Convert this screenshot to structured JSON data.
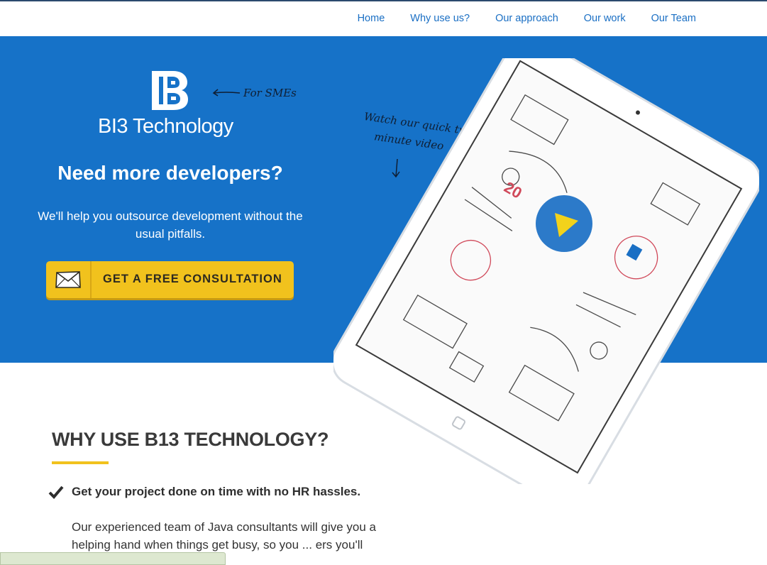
{
  "nav": {
    "items": [
      "Home",
      "Why use us?",
      "Our approach",
      "Our work",
      "Our Team"
    ]
  },
  "hero": {
    "logo_text": "BI3 Technology",
    "for_smes": "For SMEs",
    "watch_line1": "Watch our quick two",
    "watch_line2": "minute video",
    "headline": "Need more developers?",
    "subline": "We'll help you outsource development without the usual pitfalls.",
    "cta_label": "GET A FREE CONSULTATION"
  },
  "why": {
    "title": "WHY USE B13 TECHNOLOGY?",
    "benefit_title": "Get your project done on time with no HR hassles.",
    "benefit_text": "Our experienced team of Java consultants will give you a helping hand when things get busy, so you ... ers you'll no longer"
  },
  "colors": {
    "hero_blue": "#1672c8",
    "nav_link": "#1a6fc4",
    "cta_yellow": "#f1c21d",
    "accent_rule": "#f1c21d",
    "play_button": "#1a6fc4"
  },
  "icons": {
    "cta": "envelope-icon",
    "benefit": "checkmark-icon",
    "video": "play-icon"
  }
}
